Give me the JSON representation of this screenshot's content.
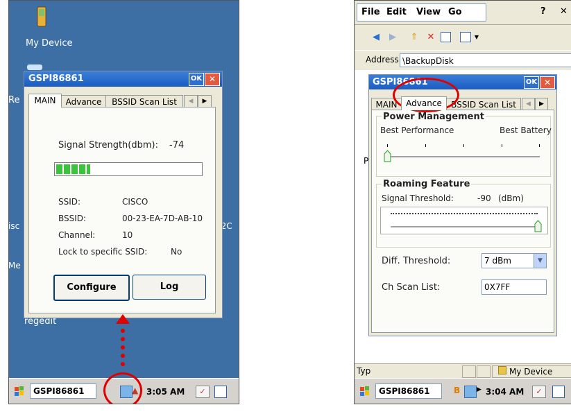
{
  "left": {
    "desktop": {
      "my_device_label": "My Device",
      "regedit_label": "regedit",
      "partial_re": "Re",
      "partial_misc": "isc",
      "partial_me": "Me",
      "partial_num": ". 2C"
    },
    "dialog": {
      "title": "GSPI86861",
      "ok_label": "OK",
      "close_label": "✕",
      "tabs": [
        "MAIN",
        "Advance",
        "BSSID Scan List"
      ],
      "signal_label": "Signal Strength(dbm):",
      "signal_value": "-74",
      "signal_level_fraction": 0.24,
      "ssid_label": "SSID:",
      "ssid_value": "CISCO",
      "bssid_label": "BSSID:",
      "bssid_value": "00-23-EA-7D-AB-10",
      "channel_label": "Channel:",
      "channel_value": "10",
      "lock_label": "Lock to specific SSID:",
      "lock_value": "No",
      "configure_label": "Configure",
      "log_label": "Log"
    },
    "taskbar": {
      "app_label": "GSPI86861",
      "time": "3:05 AM"
    }
  },
  "right": {
    "menu": [
      "File",
      "Edit",
      "View",
      "Go"
    ],
    "help_icon": "?",
    "close_icon": "✕",
    "address_label": "Address",
    "address_value": "\\BackupDisk",
    "dialog": {
      "title": "GSPI86861",
      "ok_label": "OK",
      "close_label": "✕",
      "tabs": [
        "MAIN",
        "Advance",
        "BSSID Scan List"
      ],
      "power_heading": "Power Management",
      "best_performance": "Best Performance",
      "best_battery": "Best Battery",
      "power_slider_fraction": 0.0,
      "roaming_heading": "Roaming Feature",
      "signal_threshold_label": "Signal Threshold:",
      "signal_threshold_value": "-90",
      "signal_threshold_unit": "(dBm)",
      "signal_threshold_fraction": 1.0,
      "diff_threshold_label": "Diff. Threshold:",
      "diff_threshold_value": "7 dBm",
      "ch_scan_label": "Ch Scan List:",
      "ch_scan_value": "0X7FF"
    },
    "status_type_label": "Typ",
    "status_device_label": "My Device",
    "taskbar": {
      "app_label": "GSPI86861",
      "time": "3:04 AM"
    },
    "partial_p": "P"
  },
  "colors": {
    "desktop_blue": "#3d6fa4",
    "annotation_red": "#e00000",
    "signal_green": "#3cc43c"
  }
}
